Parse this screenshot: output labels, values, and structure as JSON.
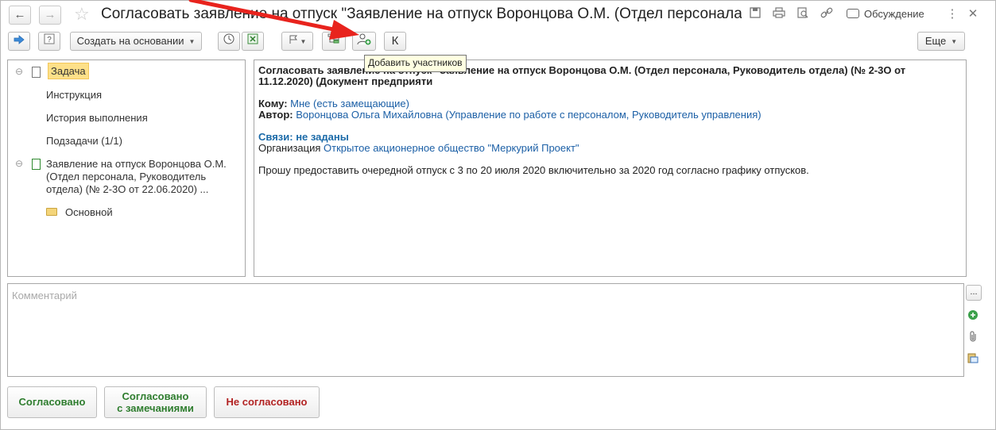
{
  "window": {
    "title": "Согласовать заявление на отпуск \"Заявление на отпуск Воронцова О.М. (Отдел персонала...",
    "discussion_label": "Обсуждение"
  },
  "toolbar": {
    "create_based_on": "Создать на основании",
    "more": "Еще",
    "k_label": "К",
    "tooltip": "Добавить участников"
  },
  "tree": {
    "items": [
      {
        "label": "Задача"
      },
      {
        "label": "Инструкция"
      },
      {
        "label": "История выполнения"
      },
      {
        "label": "Подзадачи (1/1)"
      },
      {
        "label_lines": [
          "Заявление на отпуск Воронцова О.М.",
          "(Отдел персонала, Руководитель",
          "отдела) (№ 2-3О от 22.06.2020) ..."
        ]
      },
      {
        "label": "Основной"
      }
    ]
  },
  "task": {
    "title_line1": "Согласовать заявление на отпуск \"Заявление на отпуск Воронцова О.М. (Отдел персонала, Руководитель отдела) (№ 2-3О от",
    "title_line2": "11.12.2020) (Документ предприяти",
    "to_label": "Кому:",
    "to_value": "Мне (есть замещающие)",
    "author_label": "Автор:",
    "author_value": "Воронцова Ольга Михайловна (Управление по работе с персоналом, Руководитель управления)",
    "links_label": "Связи: не заданы",
    "org_label": "Организация",
    "org_value": "Открытое акционерное общество \"Меркурий Проект\"",
    "description": "Прошу предоставить очередной отпуск с 3 по 20 июля 2020 включительно за 2020 год согласно графику отпусков."
  },
  "comment": {
    "placeholder": "Комментарий",
    "value": "",
    "more_label": "..."
  },
  "actions": {
    "approved": "Согласовано",
    "approved_remarks_line1": "Согласовано",
    "approved_remarks_line2": "с замечаниями",
    "not_approved": "Не согласовано"
  },
  "colors": {
    "approved": "#2e7d2e",
    "not_approved": "#b22222",
    "link": "#1b5fa6",
    "selection": "#fde089",
    "arrow": "#e8231d"
  }
}
